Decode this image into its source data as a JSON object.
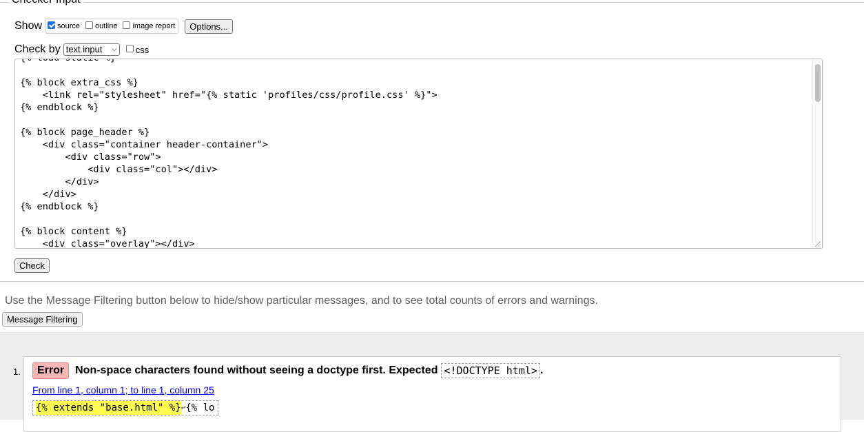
{
  "checker": {
    "legend": "Checker Input",
    "show_label": "Show",
    "show_options": [
      {
        "label": "source",
        "checked": true
      },
      {
        "label": "outline",
        "checked": false
      },
      {
        "label": "image report",
        "checked": false
      }
    ],
    "options_button": "Options...",
    "check_by_label": "Check by",
    "check_by_value": "text input",
    "css_label": "css",
    "css_checked": false,
    "source_text": "{% load static %}\n\n{% block extra_css %}\n    <link rel=\"stylesheet\" href=\"{% static 'profiles/css/profile.css' %}\">\n{% endblock %}\n\n{% block page_header %}\n    <div class=\"container header-container\">\n        <div class=\"row\">\n            <div class=\"col\"></div>\n        </div>\n    </div>\n{% endblock %}\n\n{% block content %}\n    <div class=\"overlay\"></div>",
    "check_button": "Check"
  },
  "filter_info": "Use the Message Filtering button below to hide/show particular messages, and to see total counts of errors and warnings.",
  "filter_button": "Message Filtering",
  "messages": [
    {
      "number": "1.",
      "type": "Error",
      "text": "Non-space characters found without seeing a doctype first. Expected",
      "code": "<!DOCTYPE html>",
      "period": ".",
      "location": "From line 1, column 1; to line 1, column 25",
      "extract_highlight": "{% extends \"base.html\" %}",
      "extract_linefeed": "↩",
      "extract_rest": "{% lo"
    }
  ]
}
